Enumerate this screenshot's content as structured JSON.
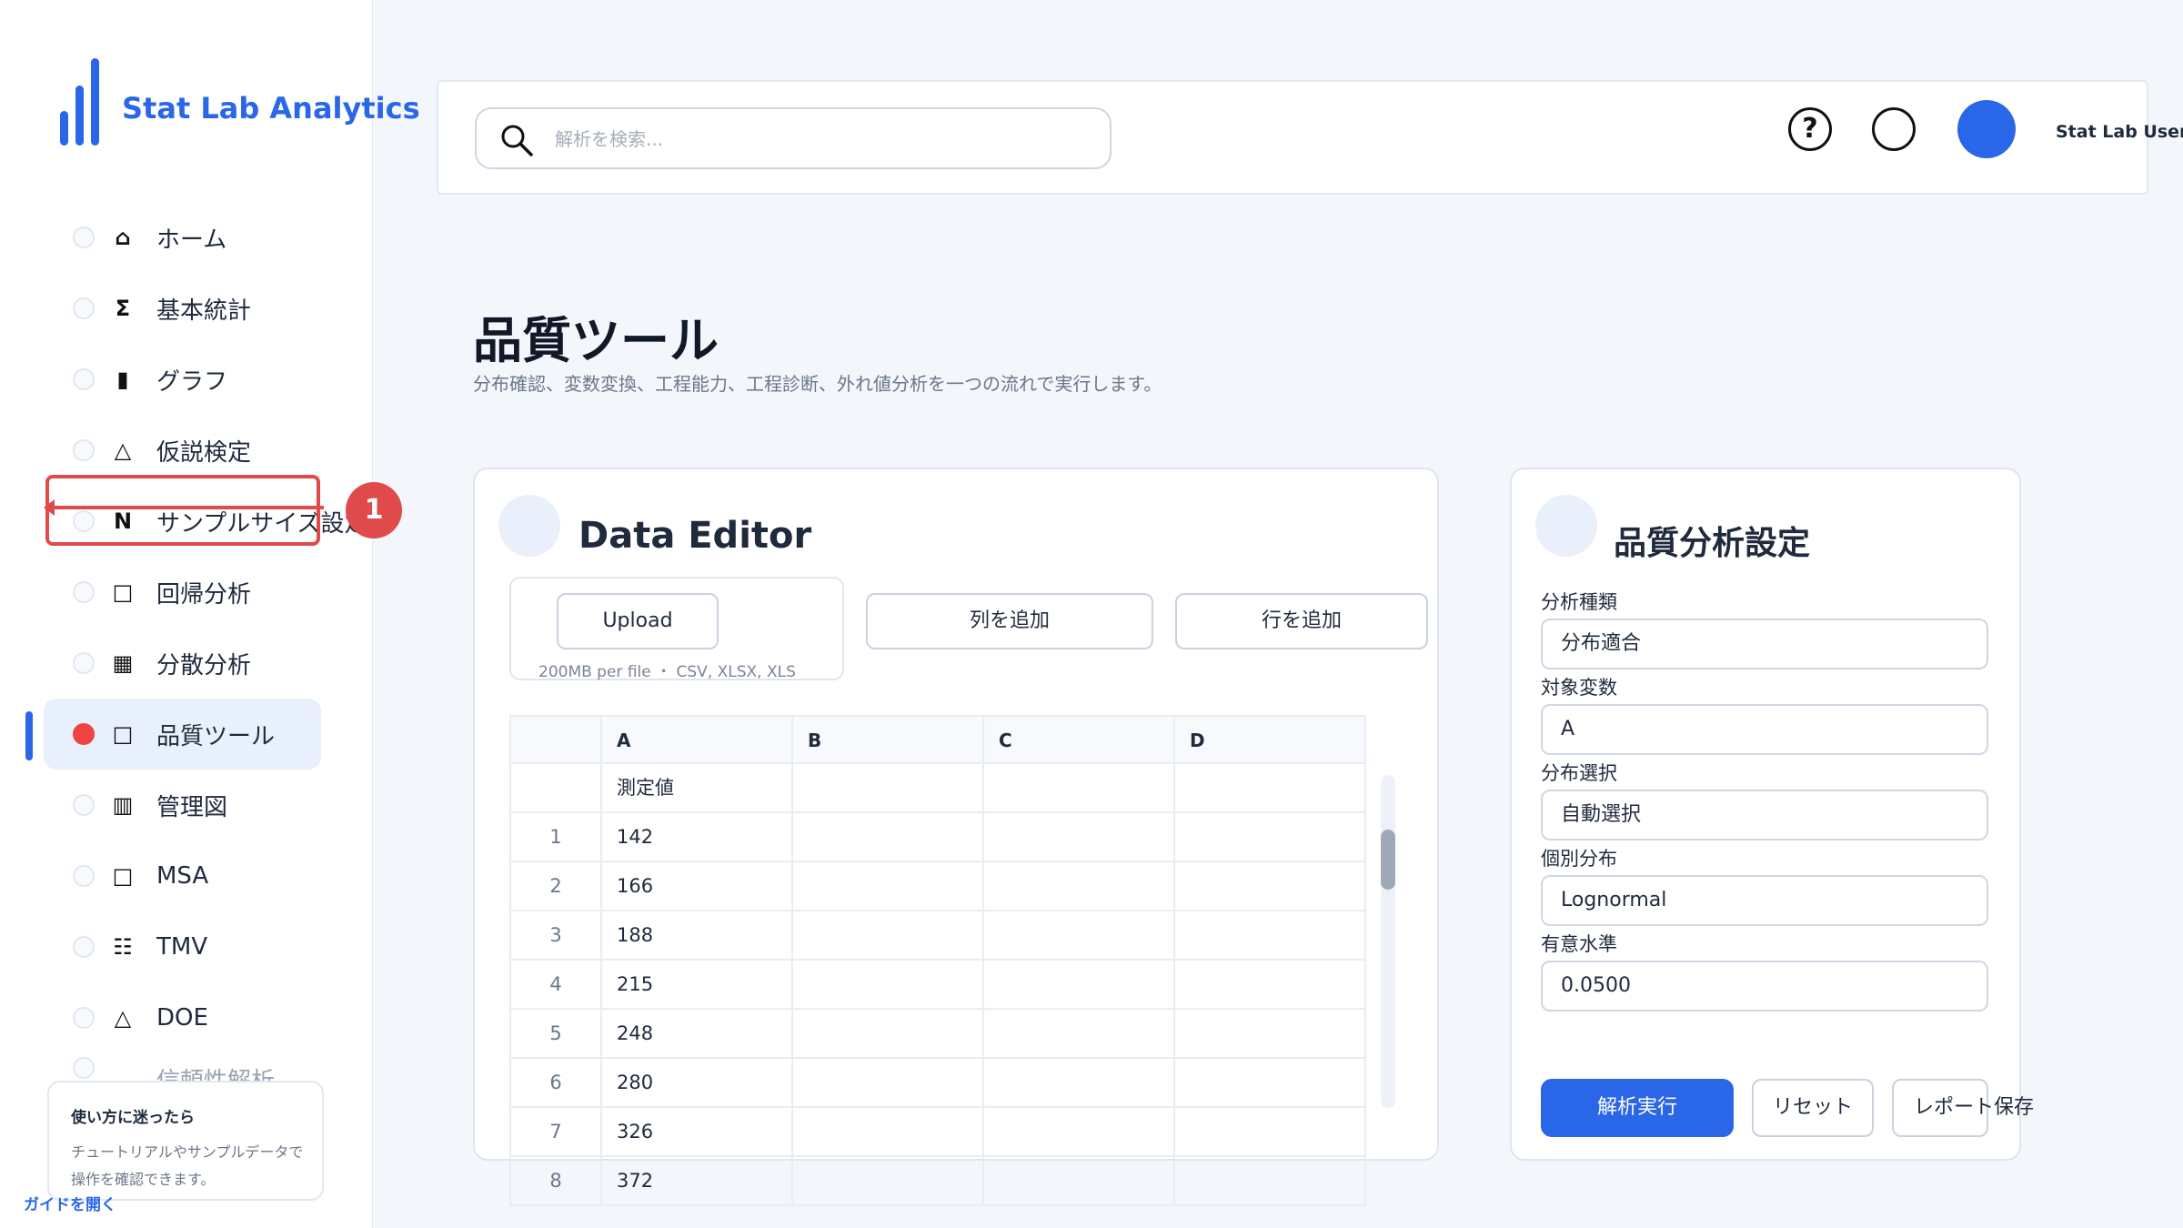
{
  "app": {
    "name": "Stat Lab Analytics"
  },
  "sidebar": {
    "items": [
      {
        "glyph": "⌂",
        "label": "ホーム",
        "icon": "home-icon"
      },
      {
        "glyph": "Σ",
        "label": "基本統計",
        "icon": "sigma-icon"
      },
      {
        "glyph": "▮",
        "label": "グラフ",
        "icon": "bar-icon"
      },
      {
        "glyph": "△",
        "label": "仮説検定",
        "icon": "triangle-icon"
      },
      {
        "glyph": "N",
        "label": "サンプルサイズ設定",
        "icon": "n-icon"
      },
      {
        "glyph": "□",
        "label": "回帰分析",
        "icon": "square-icon"
      },
      {
        "glyph": "▦",
        "label": "分散分析",
        "icon": "grid-icon"
      },
      {
        "glyph": "□",
        "label": "品質ツール",
        "icon": "square-icon",
        "active": true
      },
      {
        "glyph": "▥",
        "label": "管理図",
        "icon": "columns-icon"
      },
      {
        "glyph": "□",
        "label": "MSA",
        "icon": "square-icon"
      },
      {
        "glyph": "☷",
        "label": "TMV",
        "icon": "list-icon"
      },
      {
        "glyph": "△",
        "label": "DOE",
        "icon": "triangle-icon"
      },
      {
        "glyph": "",
        "label": "信頼性解析"
      }
    ],
    "help": {
      "title": "使い方に迷ったら",
      "body": "チュートリアルやサンプルデータで操作を確認できます。",
      "link": "ガイドを開く"
    },
    "annotation": "1"
  },
  "header": {
    "search_placeholder": "解析を検索...",
    "help_glyph": "?",
    "user": "Stat Lab User"
  },
  "page": {
    "title": "品質ツール",
    "subtitle": "分布確認、変数変換、工程能力、工程診断、外れ値分析を一つの流れで実行します。"
  },
  "editor": {
    "title": "Data Editor",
    "upload_label": "Upload",
    "upload_hint": "200MB per file ・ CSV, XLSX, XLS",
    "add_column": "列を追加",
    "add_row": "行を追加",
    "columns": [
      "",
      "A",
      "B",
      "C",
      "D"
    ],
    "rows": [
      [
        "",
        "測定値",
        "",
        "",
        ""
      ],
      [
        "1",
        "142",
        "",
        "",
        ""
      ],
      [
        "2",
        "166",
        "",
        "",
        ""
      ],
      [
        "3",
        "188",
        "",
        "",
        ""
      ],
      [
        "4",
        "215",
        "",
        "",
        ""
      ],
      [
        "5",
        "248",
        "",
        "",
        ""
      ],
      [
        "6",
        "280",
        "",
        "",
        ""
      ],
      [
        "7",
        "326",
        "",
        "",
        ""
      ],
      [
        "8",
        "372",
        "",
        "",
        ""
      ]
    ]
  },
  "settings": {
    "title": "品質分析設定",
    "fields": [
      {
        "label": "分析種類",
        "value": "分布適合"
      },
      {
        "label": "対象変数",
        "value": "A"
      },
      {
        "label": "分布選択",
        "value": "自動選択"
      },
      {
        "label": "個別分布",
        "value": "Lognormal"
      },
      {
        "label": "有意水準",
        "value": "0.0500"
      }
    ],
    "run": "解析実行",
    "reset": "リセット",
    "report": "レポート保存"
  },
  "colors": {
    "accent": "#2a66e8",
    "active_dot": "#ef4444",
    "annotation": "#e04a4a"
  }
}
